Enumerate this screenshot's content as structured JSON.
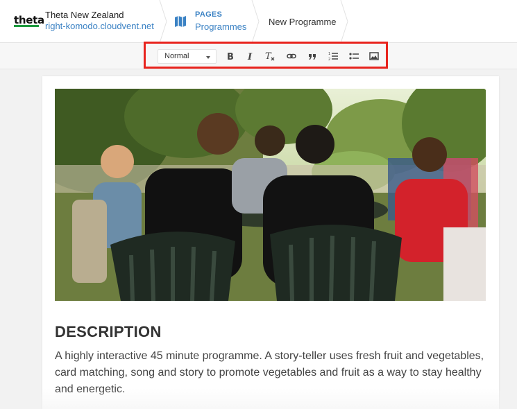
{
  "header": {
    "logo_text": "theta",
    "site_name": "Theta New Zealand",
    "site_url": "right-komodo.cloudvent.net",
    "breadcrumbs": [
      {
        "label": "PAGES",
        "sublabel": "Programmes",
        "icon": "map-icon"
      },
      {
        "label": "New Programme"
      }
    ]
  },
  "toolbar": {
    "format_value": "Normal",
    "buttons": [
      "bold-icon",
      "italic-icon",
      "clear-format-icon",
      "link-icon",
      "quote-icon",
      "numbered-list-icon",
      "bullet-list-icon",
      "image-icon"
    ],
    "highlight_color": "#e8231d"
  },
  "content": {
    "heading": "DESCRIPTION",
    "body": "A highly interactive 45 minute programme. A story-teller uses fresh fruit and vegetables, card matching, song and story to promote vegetables and fruit as a way to stay healthy and energetic."
  },
  "colors": {
    "accent": "#3b82c4",
    "logo_green": "#1e9a3f"
  }
}
